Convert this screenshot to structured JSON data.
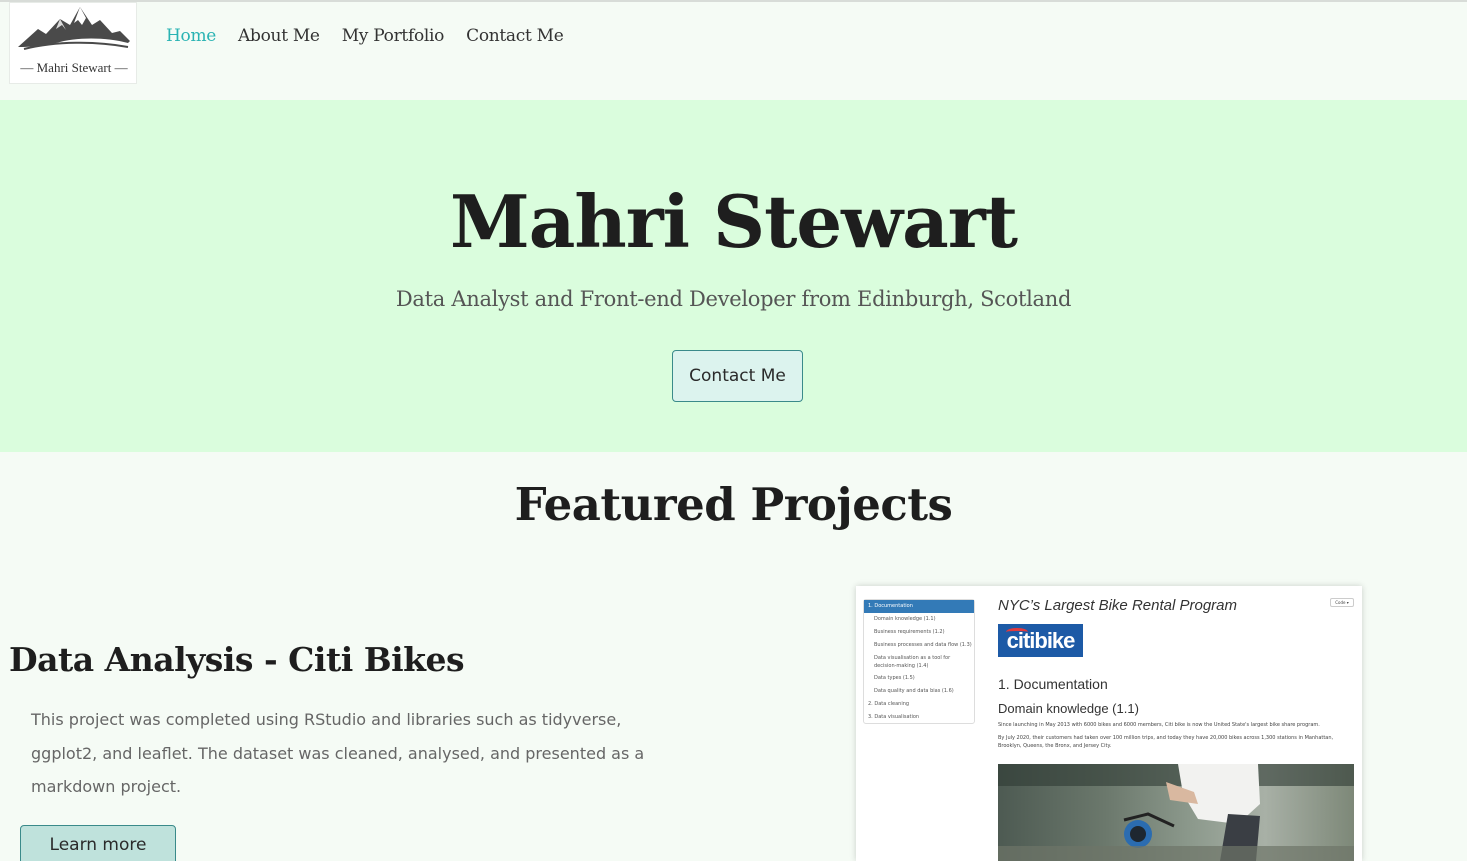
{
  "navbar": {
    "logo_text": "— Mahri Stewart —",
    "links": [
      {
        "label": "Home",
        "active": true
      },
      {
        "label": "About Me",
        "active": false
      },
      {
        "label": "My Portfolio",
        "active": false
      },
      {
        "label": "Contact Me",
        "active": false
      }
    ],
    "active_color": "#2ab3b3"
  },
  "hero": {
    "title": "Mahri Stewart",
    "subtitle": "Data Analyst and Front-end Developer from Edinburgh, Scotland",
    "button_label": "Contact Me",
    "background_color": "#dafddd"
  },
  "featured": {
    "heading": "Featured Projects",
    "project": {
      "title": "Data Analysis - Citi Bikes",
      "description": "This project was completed using RStudio and libraries such as tidyverse, ggplot2, and leaflet. The dataset was cleaned, analysed, and presented as a markdown project.",
      "button_label": "Learn more",
      "preview": {
        "toc": [
          "1. Documentation",
          "Domain knowledge (1.1)",
          "Business requirements (1.2)",
          "Business processes and data flow (1.3)",
          "Data visualisation as a tool for decision-making (1.4)",
          "Data types (1.5)",
          "Data quality and data bias (1.6)",
          "2. Data cleaning",
          "3. Data visualisation"
        ],
        "title": "NYC’s Largest Bike Rental Program",
        "code_button": "Code ▾",
        "logo_text": "citibike",
        "heading1": "1. Documentation",
        "heading2": "Domain knowledge (1.1)",
        "para1": "Since launching in May 2013 with 6000 bikes and 6000 members, Citi bike is now the United State's largest bike share program.",
        "para2": "By July 2020, their customers had taken over 100 million trips, and today they have 20,000 bikes across 1,300 stations in Manhattan, Brooklyn, Queens, the Bronx, and Jersey City."
      }
    }
  }
}
